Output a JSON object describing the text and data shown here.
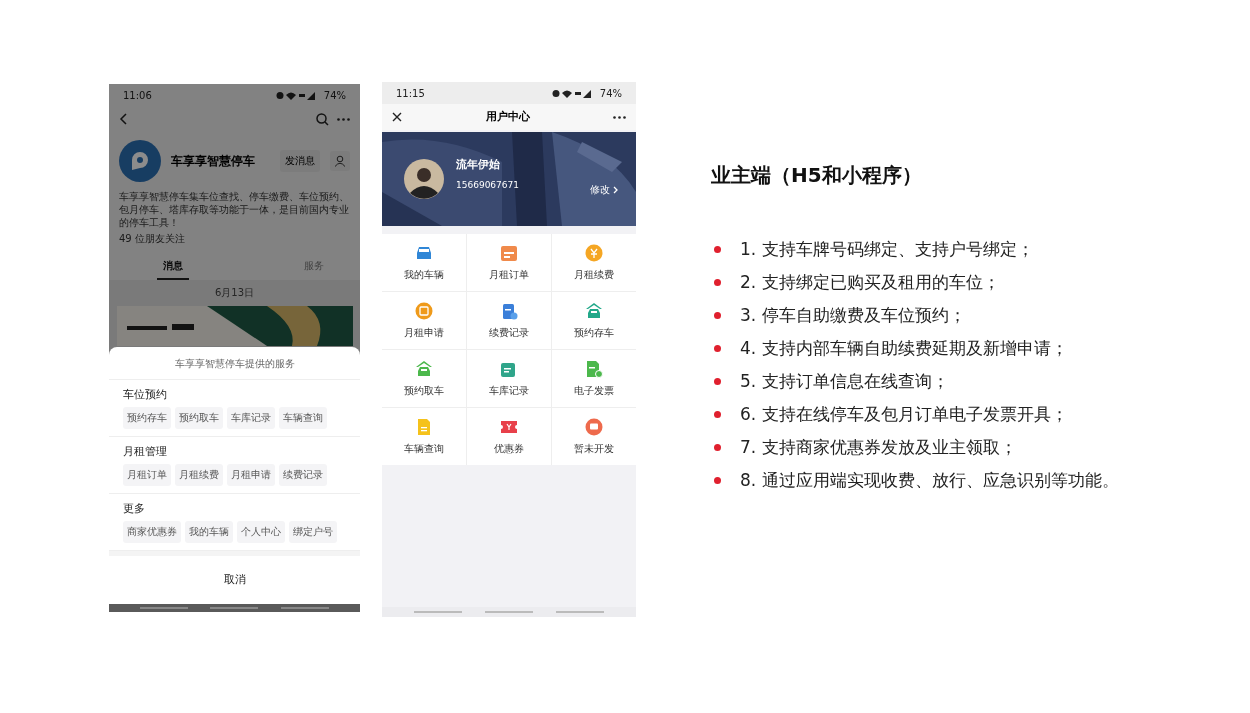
{
  "left_phone": {
    "status_bar": {
      "time": "11:06",
      "battery": "74%"
    },
    "account": {
      "name": "车享享智慧停车",
      "message_button": "发消息",
      "description": "车享享智慧停车集车位查找、停车缴费、车位预约、包月停车、塔库存取等功能于一体，是目前国内专业的停车工具！",
      "followers": "49 位朋友关注"
    },
    "tabs": [
      {
        "label": "消息",
        "selected": true
      },
      {
        "label": "服务",
        "selected": false
      }
    ],
    "feed": {
      "date": "6月13日"
    },
    "sheet": {
      "title": "车享享智慧停车提供的服务",
      "sections": [
        {
          "title": "车位预约",
          "items": [
            "预约存车",
            "预约取车",
            "车库记录",
            "车辆查询"
          ]
        },
        {
          "title": "月租管理",
          "items": [
            "月租订单",
            "月租续费",
            "月租申请",
            "续费记录"
          ]
        },
        {
          "title": "更多",
          "items": [
            "商家优惠券",
            "我的车辆",
            "个人中心",
            "绑定户号"
          ]
        }
      ],
      "cancel": "取消"
    }
  },
  "right_phone": {
    "status_bar": {
      "time": "11:15",
      "battery": "74%"
    },
    "title": "用户中心",
    "profile": {
      "name": "流年伊始",
      "phone": "15669067671",
      "edit": "修改"
    },
    "grid": [
      {
        "label": "我的车辆",
        "kind": "car",
        "color": "#2f86d6"
      },
      {
        "label": "月租订单",
        "kind": "calendar",
        "color": "#f08a4b"
      },
      {
        "label": "月租续费",
        "kind": "coin",
        "color": "#f5a623"
      },
      {
        "label": "月租申请",
        "kind": "box",
        "color": "#ef9a1a"
      },
      {
        "label": "续费记录",
        "kind": "clipboard",
        "color": "#3b7fd9"
      },
      {
        "label": "预约存车",
        "kind": "garage",
        "color": "#22a889"
      },
      {
        "label": "预约取车",
        "kind": "garage",
        "color": "#4cb84c"
      },
      {
        "label": "车库记录",
        "kind": "document",
        "color": "#2fa58a"
      },
      {
        "label": "电子发票",
        "kind": "invoice",
        "color": "#4cb84c"
      },
      {
        "label": "车辆查询",
        "kind": "file",
        "color": "#f5c21b"
      },
      {
        "label": "优惠券",
        "kind": "ticket",
        "color": "#e8404a"
      },
      {
        "label": "暂未开发",
        "kind": "chat",
        "color": "#ee6a4c"
      }
    ]
  },
  "slide": {
    "title": "业主端（H5和小程序）",
    "points": [
      "1. 支持车牌号码绑定、支持户号绑定；",
      "2. 支持绑定已购买及租用的车位；",
      "3. 停车自助缴费及车位预约；",
      "4. 支持内部车辆自助续费延期及新增申请；",
      "5. 支持订单信息在线查询；",
      "6. 支持在线停车及包月订单电子发票开具；",
      "7. 支持商家优惠券发放及业主领取；",
      "8. 通过应用端实现收费、放行、应急识别等功能。"
    ]
  }
}
